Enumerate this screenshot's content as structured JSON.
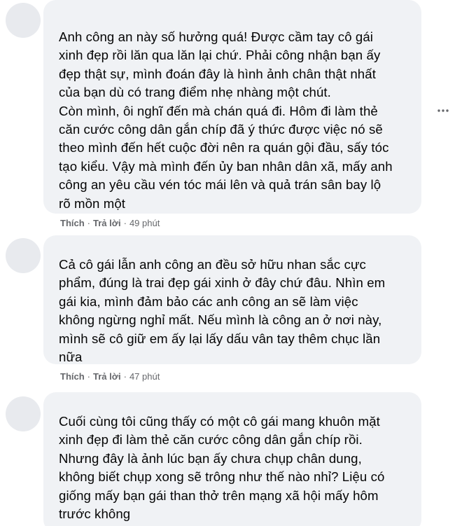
{
  "comments": [
    {
      "lines": [
        "Anh công an này số hưởng quá! Được cầm tay cô gái",
        "xinh đẹp rồi lăn qua lăn lại chứ. Phải công nhận bạn ấy",
        "đẹp thật sự, mình đoán đây là hình ảnh chân thật nhất",
        "của bạn dù có trang điểm nhẹ nhàng một chút.",
        "Còn mình, ôi nghĩ đến mà chán quá đi. Hôm đi làm thẻ",
        "căn cước công dân gắn chíp đã ý thức được việc nó sẽ",
        "theo mình đến hết cuộc đời nên ra quán gội đầu, sấy tóc",
        "tạo kiểu. Vậy mà mình đến ủy ban nhân dân xã, mấy anh",
        "công an yêu cầu vén tóc mái lên và quả trán sân bay lộ",
        "rõ mồn một"
      ],
      "like": "Thích",
      "reply": "Trả lời",
      "time": "49 phút"
    },
    {
      "lines": [
        "Cả cô gái lẫn anh công an đều sở hữu nhan sắc cực",
        "phẩm, đúng là trai đẹp gái xinh ở đây chứ đâu. Nhìn em",
        "gái kia, mình đảm bảo các anh công an sẽ làm việc",
        "không ngừng nghỉ mất. Nếu mình là công an ở nơi này,",
        "mình sẽ cô giữ em ấy lại lấy dấu vân tay thêm chục lần",
        "nữa"
      ],
      "like": "Thích",
      "reply": "Trả lời",
      "time": "47 phút"
    },
    {
      "lines": [
        "Cuối cùng tôi cũng thấy có một cô gái mang khuôn mặt",
        "xinh đẹp đi làm thẻ căn cước công dân gắn chíp rồi.",
        "Nhưng đây là ảnh lúc bạn ấy chưa chụp chân dung,",
        "không biết chụp xong sẽ trông như thế nào nhỉ? Liệu có",
        "giống mấy bạn gái than thở trên mạng xã hội mấy hôm",
        "trước không"
      ]
    }
  ],
  "icons": {
    "more": "more-options-icon",
    "avatar": "avatar"
  },
  "colors": {
    "bubble": "#f0f2f5",
    "text": "#050505",
    "meta": "#65676b"
  }
}
